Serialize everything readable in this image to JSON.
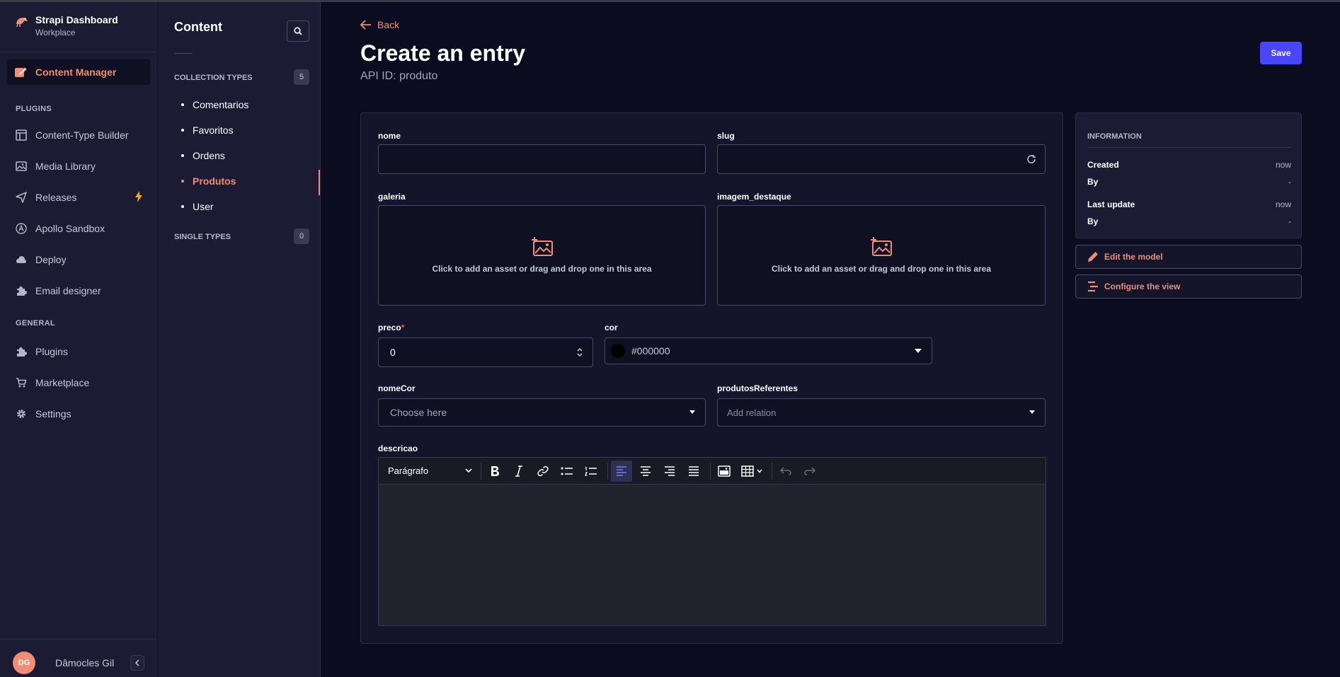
{
  "brand": {
    "title": "Strapi Dashboard",
    "subtitle": "Workplace"
  },
  "nav": {
    "active": "Content Manager",
    "plugins_title": "PLUGINS",
    "plugins": [
      "Content-Type Builder",
      "Media Library",
      "Releases",
      "Apollo Sandbox",
      "Deploy",
      "Email designer"
    ],
    "general_title": "GENERAL",
    "general": [
      "Plugins",
      "Marketplace",
      "Settings"
    ]
  },
  "user": {
    "initials": "DG",
    "name": "Dâmocles Gil"
  },
  "subnav": {
    "title": "Content",
    "collection_title": "COLLECTION TYPES",
    "collection_count": "5",
    "collection_types": [
      "Comentarios",
      "Favoritos",
      "Ordens",
      "Produtos",
      "User"
    ],
    "active_type": "Produtos",
    "single_title": "SINGLE TYPES",
    "single_count": "0"
  },
  "header": {
    "back": "Back",
    "title": "Create an entry",
    "api_id": "API ID: produto",
    "save": "Save"
  },
  "form": {
    "nome_label": "nome",
    "nome_value": "",
    "slug_label": "slug",
    "slug_value": "",
    "galeria_label": "galeria",
    "imagem_label": "imagem_destaque",
    "dropzone_text": "Click to add an asset or drag and drop one in this area",
    "preco_label": "preco",
    "preco_required": "*",
    "preco_value": "0",
    "cor_label": "cor",
    "cor_value": "#000000",
    "cor_swatch": "#000000",
    "nomeCor_label": "nomeCor",
    "nomeCor_placeholder": "Choose here",
    "produtos_label": "produtosReferentes",
    "produtos_placeholder": "Add relation",
    "descricao_label": "descricao",
    "editor_heading": "Parágrafo"
  },
  "info": {
    "title": "INFORMATION",
    "created_label": "Created",
    "created_value": "now",
    "by1_label": "By",
    "by1_value": "-",
    "updated_label": "Last update",
    "updated_value": "now",
    "by2_label": "By",
    "by2_value": "-"
  },
  "actions": {
    "edit_model": "Edit the model",
    "configure_view": "Configure the view"
  },
  "colors": {
    "accent": "#ee8e76",
    "primary": "#4945ff",
    "background": "#0b0c1f",
    "sidebar": "#1b1b33"
  }
}
